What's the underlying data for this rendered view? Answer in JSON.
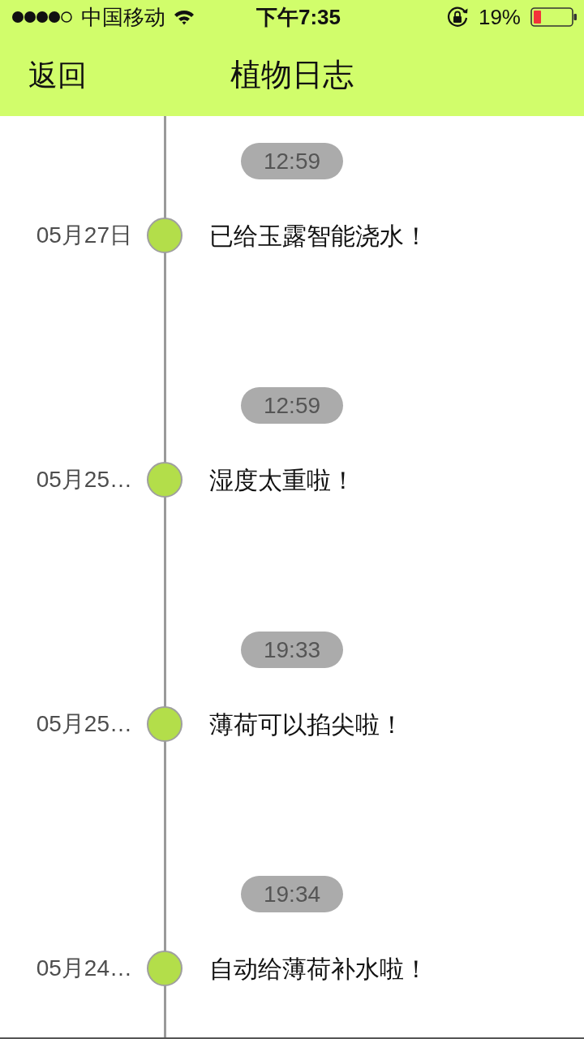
{
  "status_bar": {
    "carrier": "中国移动",
    "time": "下午7:35",
    "battery": "19%"
  },
  "nav_bar": {
    "back": "返回",
    "title": "植物日志"
  },
  "entries": [
    {
      "time": "12:59",
      "date": "05月27日",
      "message": "已给玉露智能浇水！"
    },
    {
      "time": "12:59",
      "date": "05月25…",
      "message": "湿度太重啦！"
    },
    {
      "time": "19:33",
      "date": "05月25…",
      "message": "薄荷可以掐尖啦！"
    },
    {
      "time": "19:34",
      "date": "05月24…",
      "message": "自动给薄荷补水啦！"
    }
  ]
}
